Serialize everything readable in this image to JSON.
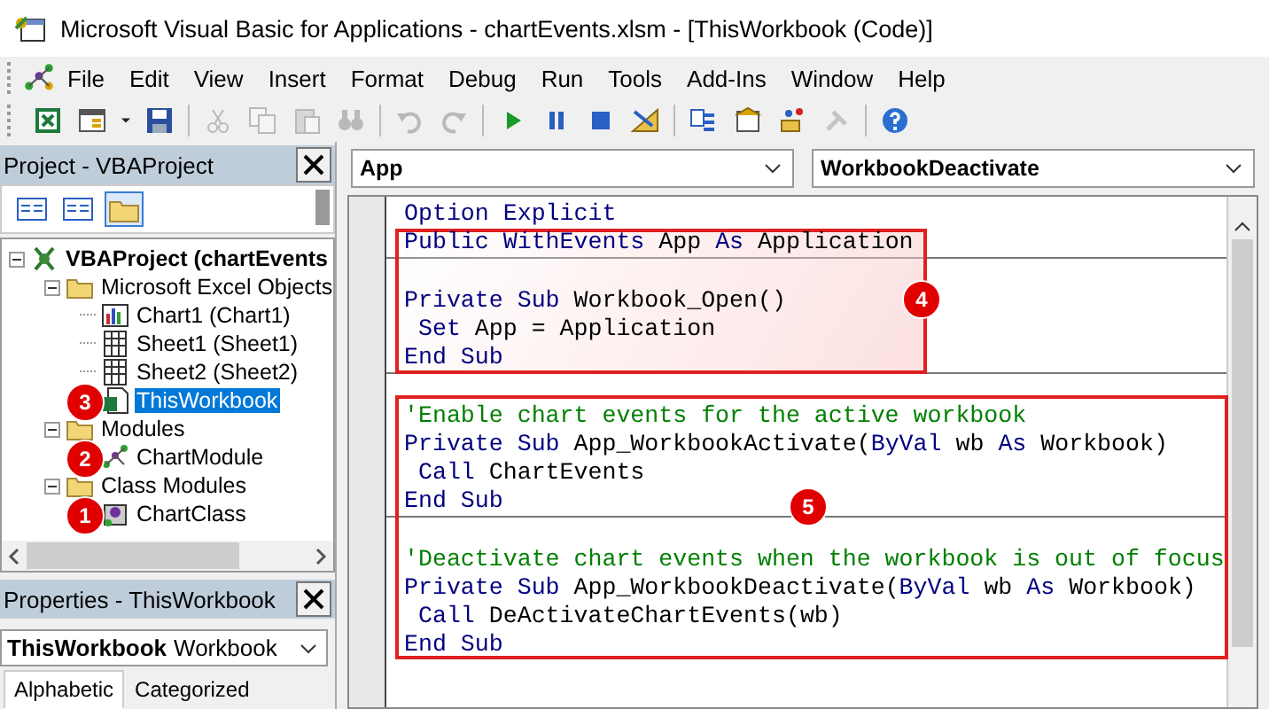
{
  "window": {
    "title": "Microsoft Visual Basic for Applications - chartEvents.xlsm - [ThisWorkbook (Code)]"
  },
  "menu": [
    "File",
    "Edit",
    "View",
    "Insert",
    "Format",
    "Debug",
    "Run",
    "Tools",
    "Add-Ins",
    "Window",
    "Help"
  ],
  "toolbar": [
    {
      "kind": "excel",
      "disabled": false
    },
    {
      "kind": "userform",
      "disabled": false
    },
    {
      "kind": "caret",
      "disabled": false
    },
    {
      "kind": "save",
      "disabled": false
    },
    {
      "kind": "sep"
    },
    {
      "kind": "cut",
      "disabled": true
    },
    {
      "kind": "copy",
      "disabled": true
    },
    {
      "kind": "paste",
      "disabled": true
    },
    {
      "kind": "find",
      "disabled": true
    },
    {
      "kind": "sep"
    },
    {
      "kind": "undo",
      "disabled": true
    },
    {
      "kind": "redo",
      "disabled": true
    },
    {
      "kind": "sep"
    },
    {
      "kind": "run",
      "disabled": false
    },
    {
      "kind": "pause",
      "disabled": false
    },
    {
      "kind": "stop",
      "disabled": false
    },
    {
      "kind": "design",
      "disabled": false
    },
    {
      "kind": "sep"
    },
    {
      "kind": "explorer",
      "disabled": false
    },
    {
      "kind": "properties",
      "disabled": false
    },
    {
      "kind": "browser",
      "disabled": false
    },
    {
      "kind": "toolbox",
      "disabled": true
    },
    {
      "kind": "sep"
    },
    {
      "kind": "help",
      "disabled": false
    }
  ],
  "project_panel": {
    "title": "Project - VBAProject",
    "tools": [
      {
        "kind": "view-code",
        "selected": false
      },
      {
        "kind": "view-object",
        "selected": false
      },
      {
        "kind": "toggle-folders",
        "selected": true
      }
    ],
    "tree": [
      {
        "label": "VBAProject (chartEvents",
        "kind": "project",
        "expanded": true,
        "selected": false,
        "children": [
          {
            "label": "Microsoft Excel Objects",
            "kind": "folder",
            "expanded": true,
            "selected": false,
            "children": [
              {
                "label": "Chart1 (Chart1)",
                "kind": "chart",
                "selected": false
              },
              {
                "label": "Sheet1 (Sheet1)",
                "kind": "sheet",
                "selected": false
              },
              {
                "label": "Sheet2 (Sheet2)",
                "kind": "sheet",
                "selected": false
              },
              {
                "label": "ThisWorkbook",
                "kind": "workbook",
                "selected": true,
                "badge": "3"
              }
            ]
          },
          {
            "label": "Modules",
            "kind": "folder",
            "expanded": true,
            "selected": false,
            "children": [
              {
                "label": "ChartModule",
                "kind": "module",
                "selected": false,
                "badge": "2"
              }
            ]
          },
          {
            "label": "Class Modules",
            "kind": "folder",
            "expanded": true,
            "selected": false,
            "children": [
              {
                "label": "ChartClass",
                "kind": "class",
                "selected": false,
                "badge": "1"
              }
            ]
          }
        ]
      }
    ]
  },
  "properties_panel": {
    "title": "Properties - ThisWorkbook",
    "object": {
      "name": "ThisWorkbook",
      "type": "Workbook"
    },
    "tabs": [
      {
        "label": "Alphabetic",
        "selected": true
      },
      {
        "label": "Categorized",
        "selected": false
      }
    ]
  },
  "code_window": {
    "object_dropdown": "App",
    "procedure_dropdown": "WorkbookDeactivate",
    "sections": [
      [
        [
          {
            "text": "Option Explicit",
            "kind": "keyword"
          }
        ],
        [
          {
            "text": "Public WithEvents ",
            "kind": "keyword"
          },
          {
            "text": "App ",
            "kind": "plain"
          },
          {
            "text": "As ",
            "kind": "keyword"
          },
          {
            "text": "Application",
            "kind": "plain"
          }
        ]
      ],
      [
        [
          {
            "text": "Private Sub ",
            "kind": "keyword"
          },
          {
            "text": "Workbook_Open()",
            "kind": "plain"
          }
        ],
        [
          {
            "text": " Set ",
            "kind": "keyword"
          },
          {
            "text": "App = Application",
            "kind": "plain"
          }
        ],
        [
          {
            "text": "End Sub",
            "kind": "keyword"
          }
        ]
      ],
      [
        [
          {
            "text": "'Enable chart events for the active workbook",
            "kind": "comment"
          }
        ],
        [
          {
            "text": "Private Sub ",
            "kind": "keyword"
          },
          {
            "text": "App_WorkbookActivate(",
            "kind": "plain"
          },
          {
            "text": "ByVal ",
            "kind": "keyword"
          },
          {
            "text": "wb ",
            "kind": "plain"
          },
          {
            "text": "As ",
            "kind": "keyword"
          },
          {
            "text": "Workbook)",
            "kind": "plain"
          }
        ],
        [
          {
            "text": " Call ",
            "kind": "keyword"
          },
          {
            "text": "ChartEvents",
            "kind": "plain"
          }
        ],
        [
          {
            "text": "End Sub",
            "kind": "keyword"
          }
        ]
      ],
      [
        [
          {
            "text": "'Deactivate chart events when the workbook is out of focus",
            "kind": "comment"
          }
        ],
        [
          {
            "text": "Private Sub ",
            "kind": "keyword"
          },
          {
            "text": "App_WorkbookDeactivate(",
            "kind": "plain"
          },
          {
            "text": "ByVal ",
            "kind": "keyword"
          },
          {
            "text": "wb ",
            "kind": "plain"
          },
          {
            "text": "As ",
            "kind": "keyword"
          },
          {
            "text": "Workbook)",
            "kind": "plain"
          }
        ],
        [
          {
            "text": " Call ",
            "kind": "keyword"
          },
          {
            "text": "DeActivateChartEvents(wb)",
            "kind": "plain"
          }
        ],
        [
          {
            "text": "End Sub",
            "kind": "keyword"
          }
        ]
      ]
    ],
    "callouts": [
      {
        "badge": "4",
        "kind": "shaded"
      },
      {
        "badge": "5",
        "kind": "outline"
      }
    ]
  }
}
